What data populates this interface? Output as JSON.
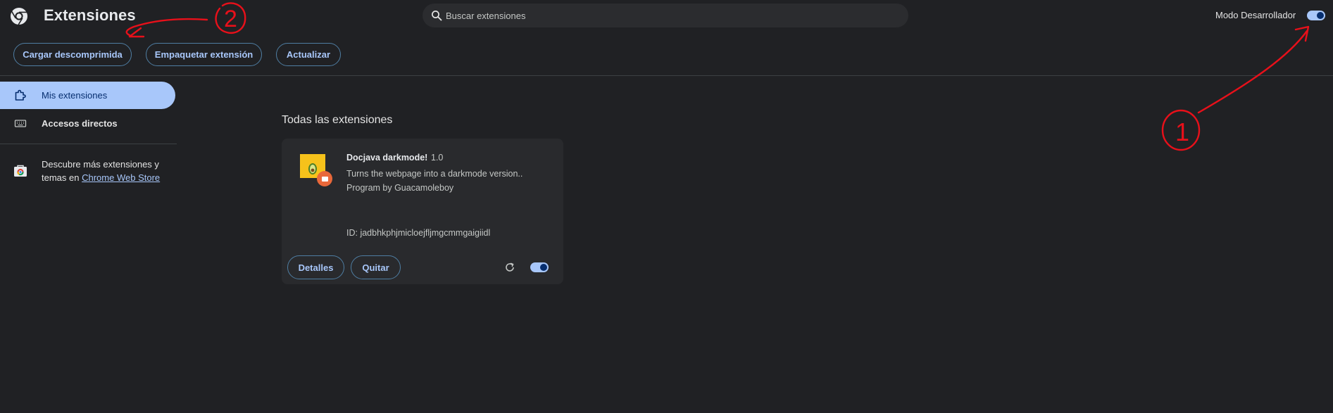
{
  "header": {
    "title": "Extensiones",
    "logo_icon": "chrome-logo-icon",
    "search_placeholder": "Buscar extensiones",
    "search_icon": "search-icon",
    "dev_mode_label": "Modo Desarrollador",
    "dev_mode_enabled": true
  },
  "toolbar": {
    "load_unpacked": "Cargar descomprimida",
    "pack_extension": "Empaquetar extensión",
    "update": "Actualizar"
  },
  "sidebar": {
    "items": [
      {
        "label": "Mis extensiones",
        "icon": "puzzle-icon",
        "active": true
      },
      {
        "label": "Accesos directos",
        "icon": "keyboard-icon",
        "active": false
      }
    ],
    "store_text": "Descubre más extensiones y temas en",
    "store_link": "Chrome Web Store",
    "store_icon": "chrome-web-store-icon"
  },
  "main": {
    "section_title": "Todas las extensiones",
    "extension": {
      "name": "Docjava darkmode!",
      "version": "1.0",
      "description": "Turns the webpage into a darkmode version..",
      "author": "Program by Guacamoleboy",
      "id": "ID: jadbhkphjmicloejfljmgcmmgaigiidl",
      "details_label": "Detalles",
      "remove_label": "Quitar",
      "enabled": true
    }
  },
  "annotations": {
    "label_1": "1",
    "label_2": "2",
    "color": "#e8101a"
  },
  "colors": {
    "background": "#202124",
    "accent": "#a8c7fa",
    "card": "#292a2d",
    "icon_yellow": "#f6c21b",
    "badge_orange": "#e9683a"
  }
}
